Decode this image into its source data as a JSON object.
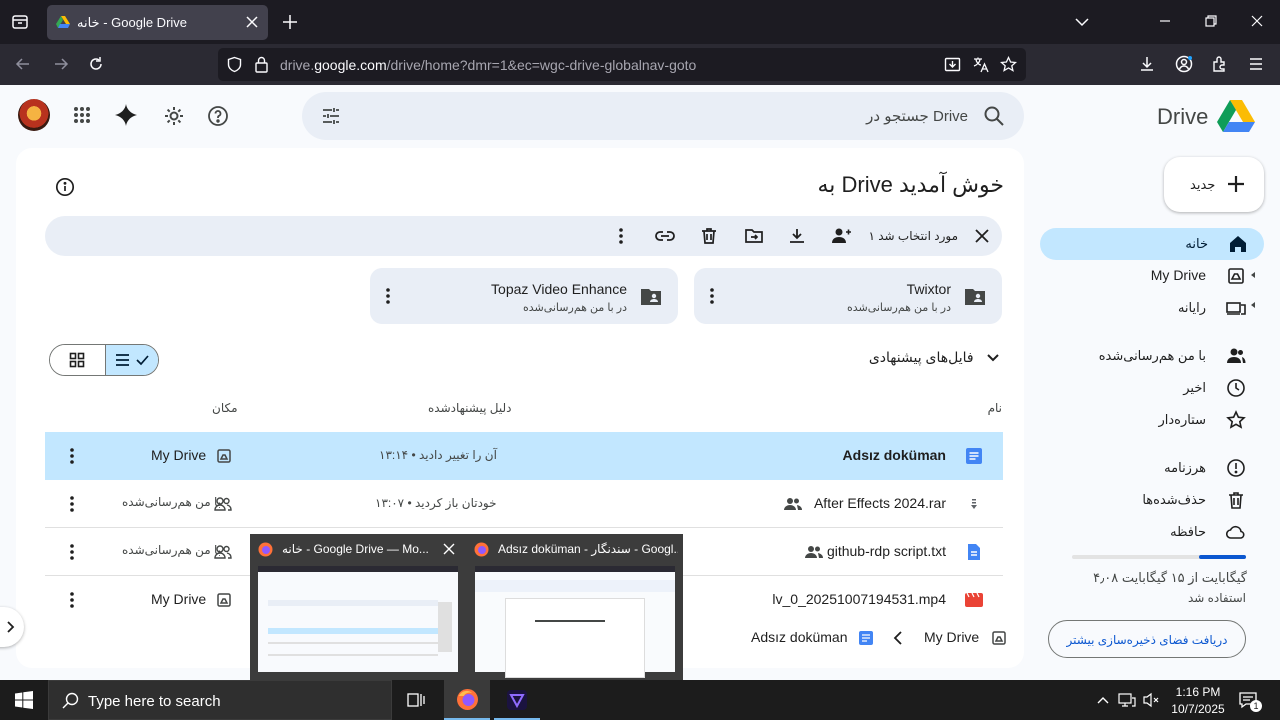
{
  "browser": {
    "tab_title": "خانه - Google Drive",
    "url_prefix": "drive.",
    "url_domain": "google.com",
    "url_path": "/drive/home?dmr=1&ec=wgc-drive-globalnav-goto"
  },
  "header": {
    "logo_text": "Drive",
    "search_placeholder": "جستجو در Drive"
  },
  "sidebar": {
    "new_label": "جدید",
    "items": [
      {
        "label": "خانه",
        "icon": "home-icon",
        "active": true
      },
      {
        "label": "My Drive",
        "icon": "drive-icon"
      },
      {
        "label": "رایانه",
        "icon": "computers-icon"
      },
      {
        "label": "با من هم‌رسانی‌شده",
        "icon": "people-icon"
      },
      {
        "label": "اخیر",
        "icon": "clock-icon"
      },
      {
        "label": "ستاره‌دار",
        "icon": "star-icon"
      },
      {
        "label": "هرزنامه",
        "icon": "spam-icon"
      },
      {
        "label": "حذف‌شده‌ها",
        "icon": "trash-icon"
      },
      {
        "label": "حافظه",
        "icon": "cloud-icon"
      }
    ],
    "storage_text": "۴٫۰۸ گیگابایت از ۱۵ گیگابایت",
    "storage_used_label": "استفاده شد",
    "storage_fraction": 0.27,
    "storage_button": "دریافت فضای ذخیره‌سازی بیشتر"
  },
  "main": {
    "welcome": "به Drive خوش آمدید",
    "selection_text": "۱ مورد انتخاب شد",
    "folders": [
      {
        "name": "Twixtor",
        "sub": "در با من هم‌رسانی‌شده"
      },
      {
        "name": "Topaz Video Enhance",
        "sub": "در با من هم‌رسانی‌شده"
      }
    ],
    "suggested_label": "فایل‌های پیشنهادی",
    "columns": {
      "name": "نام",
      "reason": "دلیل پیشنهادشده",
      "location": "مکان"
    },
    "files": [
      {
        "name": "Adsız doküman",
        "reason": "آن را تغییر دادید • ۱۳:۱۴",
        "location": "My Drive",
        "icon": "docs-icon",
        "selected": true
      },
      {
        "name": "After Effects 2024.rar",
        "reason": "خودتان باز کردید • ۱۳:۰۷",
        "location": "با من هم‌رسانی‌شده",
        "icon": "archive-icon"
      },
      {
        "name": "github-rdp script.txt",
        "reason": "",
        "location": "با من هم‌رسانی‌شده",
        "icon": "text-file-icon"
      },
      {
        "name": "lv_0_20251007194531.mp4",
        "reason": "",
        "location": "My Drive",
        "icon": "video-icon"
      }
    ],
    "breadcrumb": {
      "current": "Adsız doküman",
      "parent": "My Drive"
    }
  },
  "thumbnails": [
    {
      "title": "خانه - Google Drive — Mo..."
    },
    {
      "title": "Adsız doküman - سندنگار - Googl..."
    }
  ],
  "taskbar": {
    "search_placeholder": "Type here to search",
    "time": "1:16 PM",
    "date": "10/7/2025",
    "notification_count": "1"
  }
}
